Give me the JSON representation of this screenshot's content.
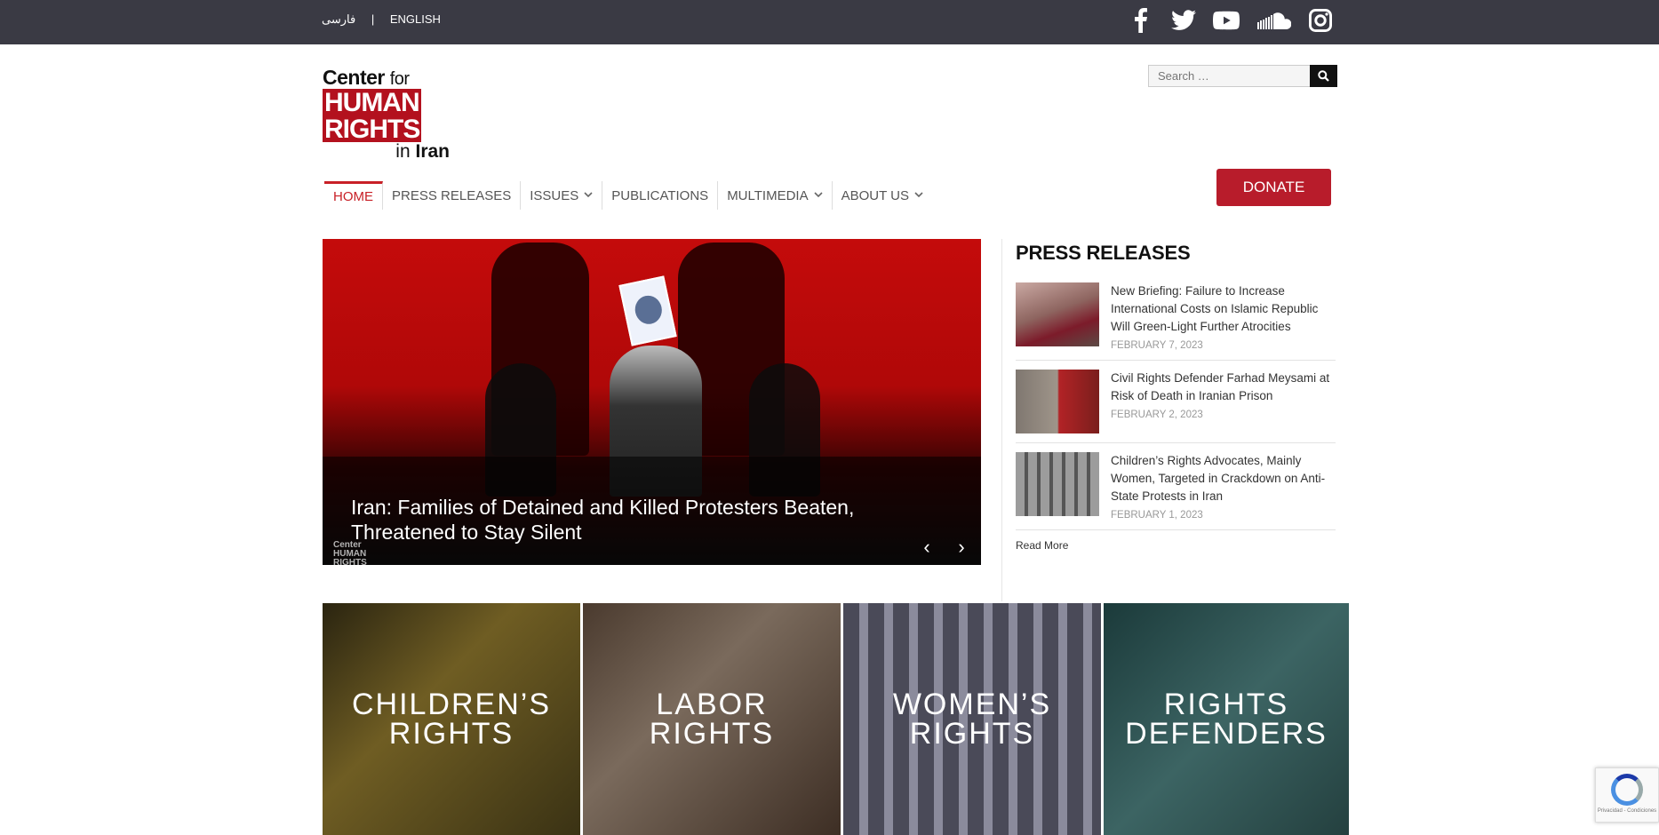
{
  "topbar": {
    "lang_fa": "فارسی",
    "separator": "|",
    "lang_en": "ENGLISH",
    "social_icons": [
      "facebook-icon",
      "twitter-icon",
      "youtube-icon",
      "soundcloud-icon",
      "instagram-icon"
    ]
  },
  "logo": {
    "line1_bold": "Center",
    "line1_light": "for",
    "line2": "HUMAN",
    "line3": "RIGHTS",
    "line4_light": "in",
    "line4_bold": "Iran"
  },
  "search": {
    "placeholder": "Search …"
  },
  "nav": {
    "items": [
      {
        "label": "HOME",
        "has_dropdown": false
      },
      {
        "label": "PRESS RELEASES",
        "has_dropdown": false
      },
      {
        "label": "ISSUES",
        "has_dropdown": true
      },
      {
        "label": "PUBLICATIONS",
        "has_dropdown": false
      },
      {
        "label": "MULTIMEDIA",
        "has_dropdown": true
      },
      {
        "label": "ABOUT US",
        "has_dropdown": true
      }
    ],
    "active_index": 0,
    "donate_label": "DONATE"
  },
  "slider": {
    "title": "Iran: Families of Detained and Killed Protesters Beaten, Threatened to Stay Silent",
    "prev_symbol": "‹",
    "next_symbol": "›"
  },
  "press_releases": {
    "heading": "PRESS RELEASES",
    "items": [
      {
        "title": "New Briefing: Failure to Increase International Costs on Islamic Republic Will Green-Light Further Atrocities",
        "date": "FEBRUARY 7, 2023"
      },
      {
        "title": "Civil Rights Defender Farhad Meysami at Risk of Death in Iranian Prison",
        "date": "FEBRUARY 2, 2023"
      },
      {
        "title": "Children’s Rights Advocates, Mainly Women, Targeted in Crackdown on Anti-State Protests in Iran",
        "date": "FEBRUARY 1, 2023"
      }
    ],
    "read_more": "Read More"
  },
  "tiles": [
    {
      "line1": "CHILDREN’S",
      "line2": "RIGHTS"
    },
    {
      "line1": "LABOR",
      "line2": "RIGHTS"
    },
    {
      "line1": "WOMEN’S",
      "line2": "RIGHTS"
    },
    {
      "line1": "RIGHTS",
      "line2": "DEFENDERS"
    }
  ],
  "recaptcha": {
    "text": "Privacidad - Condiciones"
  },
  "colors": {
    "topbar": "#3a3a44",
    "brand_red": "#b3111e",
    "active_nav": "#c82027",
    "donate": "#b81c2b"
  }
}
